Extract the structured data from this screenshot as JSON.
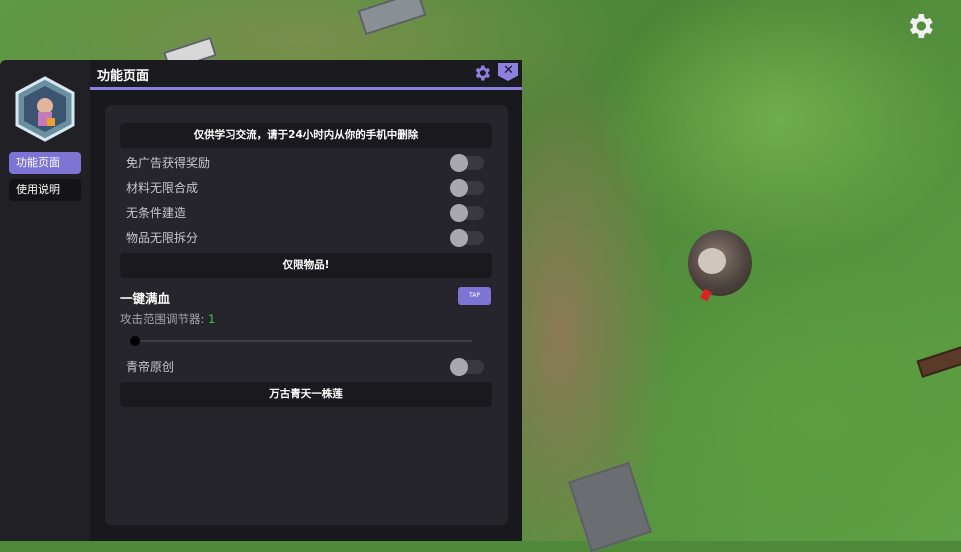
{
  "panel": {
    "title": "功能页面",
    "header_icons": [
      "gear-icon",
      "close-icon"
    ]
  },
  "sidebar": {
    "items": [
      {
        "label": "功能页面",
        "active": true
      },
      {
        "label": "使用说明",
        "active": false
      }
    ]
  },
  "content": {
    "notice": "仅供学习交流，请于24小时内从你的手机中删除",
    "toggles": [
      {
        "label": "免广告获得奖励",
        "on": false
      },
      {
        "label": "材料无限合成",
        "on": false
      },
      {
        "label": "无条件建造",
        "on": false
      },
      {
        "label": "物品无限拆分",
        "on": false
      }
    ],
    "items_only_banner": "仅限物品!",
    "full_hp": {
      "label": "一键满血",
      "button": "TAP"
    },
    "attack_range": {
      "label": "攻击范围调节器:",
      "value": "1"
    },
    "credit_toggle": {
      "label": "青帝原创",
      "on": false
    },
    "footer_banner": "万古青天一株莲"
  },
  "colors": {
    "accent": "#7e74d6",
    "panel_bg": "#19181c",
    "card_bg": "#26252b",
    "slider_value": "#38c938"
  },
  "icons": {
    "overlay_settings": "gear-icon",
    "avatar": "hexagon-avatar-icon"
  }
}
